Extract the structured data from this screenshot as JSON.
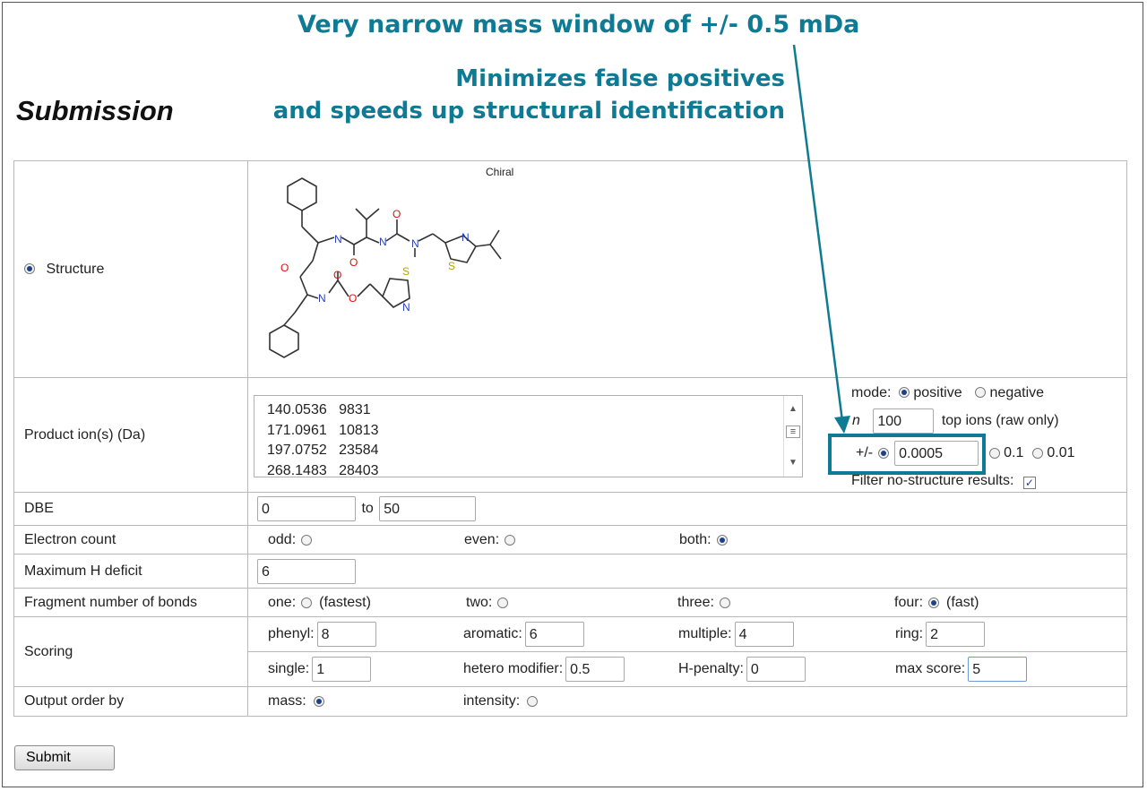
{
  "annotations": {
    "headline": "Very narrow mass window of +/- 0.5 mDa",
    "line1": "Minimizes false positives",
    "line2": "and speeds up structural identification",
    "color": "#0f7a94"
  },
  "page_title": "Submission",
  "structure": {
    "label": "Structure",
    "chiral_label": "Chiral"
  },
  "product_ions": {
    "label": "Product ion(s) (Da)",
    "lines": [
      "140.0536   9831",
      "171.0961   10813",
      "197.0752   23584",
      "268.1483   28403"
    ],
    "mode_label": "mode:",
    "positive_label": "positive",
    "negative_label": "negative",
    "n_label": "n",
    "n_value": "100",
    "top_ions_label": "top ions (raw only)",
    "pm_label": "+/-",
    "tolerance_value": "0.0005",
    "opt_01": "0.1",
    "opt_001": "0.01",
    "filter_label": "Filter no-structure results:"
  },
  "dbe": {
    "label": "DBE",
    "from": "0",
    "to_label": "to",
    "to": "50"
  },
  "electron_count": {
    "label": "Electron count",
    "odd": "odd:",
    "even": "even:",
    "both": "both:"
  },
  "max_h": {
    "label": "Maximum H deficit",
    "value": "6"
  },
  "fragment": {
    "label": "Fragment number of bonds",
    "one": "one:",
    "one_note": "(fastest)",
    "two": "two:",
    "three": "three:",
    "four": "four:",
    "four_note": "(fast)"
  },
  "scoring": {
    "label": "Scoring",
    "phenyl_label": "phenyl:",
    "phenyl": "8",
    "aromatic_label": "aromatic:",
    "aromatic": "6",
    "multiple_label": "multiple:",
    "multiple": "4",
    "ring_label": "ring:",
    "ring": "2",
    "single_label": "single:",
    "single": "1",
    "hetero_label": "hetero modifier:",
    "hetero": "0.5",
    "hpen_label": "H-penalty:",
    "hpen": "0",
    "max_label": "max score:",
    "max": "5"
  },
  "output": {
    "label": "Output order by",
    "mass": "mass:",
    "intensity": "intensity:"
  },
  "submit_label": "Submit",
  "molecule_atoms": {
    "n": "N",
    "o": "O",
    "s": "S"
  }
}
